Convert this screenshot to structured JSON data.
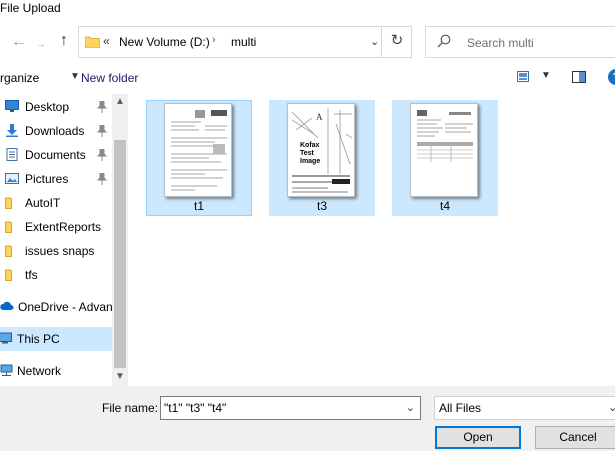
{
  "window": {
    "title": "File Upload"
  },
  "nav": {
    "back": "←",
    "forward": "→",
    "up": "↑"
  },
  "address": {
    "chevron": "«",
    "segment1": "New Volume (D:)",
    "separator": "›",
    "segment2": "multi",
    "dropdown": "⌄",
    "refresh": "↻"
  },
  "search": {
    "placeholder": "Search multi"
  },
  "toolbar": {
    "organize": "rganize",
    "new_folder": "New folder",
    "help": "?"
  },
  "sidebar": {
    "items": [
      {
        "label": "Desktop",
        "icon": "desktop-icon",
        "pinned": true
      },
      {
        "label": "Downloads",
        "icon": "download-icon",
        "pinned": true
      },
      {
        "label": "Documents",
        "icon": "documents-icon",
        "pinned": true
      },
      {
        "label": "Pictures",
        "icon": "pictures-icon",
        "pinned": true
      },
      {
        "label": "AutoIT",
        "icon": "folder-icon",
        "pinned": false
      },
      {
        "label": "ExtentReports",
        "icon": "folder-icon",
        "pinned": false
      },
      {
        "label": "issues snaps",
        "icon": "folder-icon",
        "pinned": false
      },
      {
        "label": "tfs",
        "icon": "folder-icon",
        "pinned": false
      },
      {
        "label": "OneDrive - Advan",
        "icon": "onedrive-icon",
        "pinned": false
      },
      {
        "label": "This PC",
        "icon": "computer-icon",
        "pinned": false,
        "selected": true
      },
      {
        "label": "Network",
        "icon": "network-icon",
        "pinned": false
      }
    ]
  },
  "files": [
    {
      "name": "t1",
      "selected": true,
      "focused": true
    },
    {
      "name": "t3",
      "selected": true,
      "thumb_text": [
        "Kofax",
        "Test",
        "Image"
      ]
    },
    {
      "name": "t4",
      "selected": true
    }
  ],
  "footer": {
    "filename_label": "File name:",
    "filename_value": "\"t1\" \"t3\" \"t4\"",
    "filetype_value": "All Files",
    "open_label": "Open",
    "cancel_label": "Cancel"
  },
  "colors": {
    "selection": "#cce8ff",
    "accent": "#0078d7",
    "help_bg": "#1c6fc9",
    "folder": "#ffd35c"
  }
}
